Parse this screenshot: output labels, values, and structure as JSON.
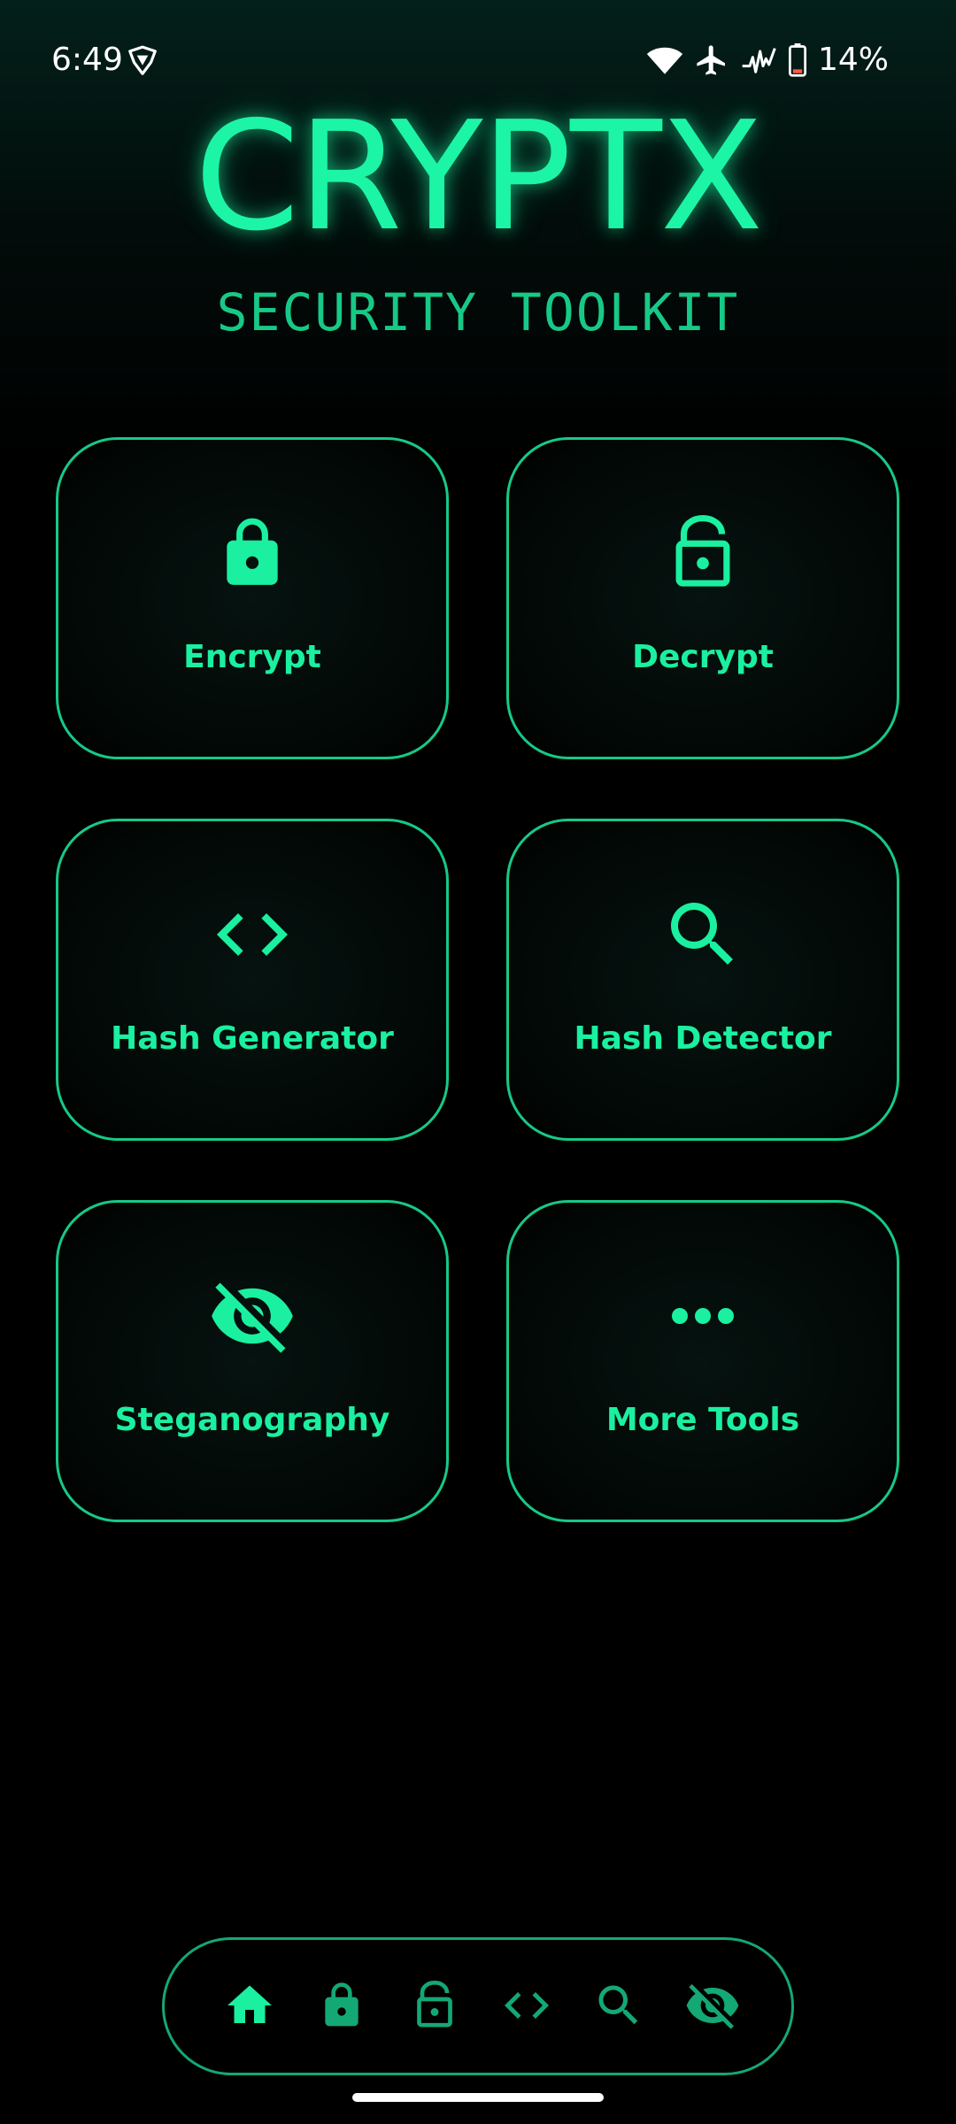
{
  "status_bar": {
    "time": "6:49",
    "battery_percent": "14%",
    "icons": [
      "vpn-shield-icon",
      "wifi-icon",
      "airplane-mode-icon",
      "signal-activity-icon",
      "battery-icon"
    ]
  },
  "header": {
    "title": "CRYPTX",
    "subtitle": "SECURITY TOOLKIT"
  },
  "tools": [
    {
      "label": "Encrypt",
      "icon": "lock-icon"
    },
    {
      "label": "Decrypt",
      "icon": "unlock-icon"
    },
    {
      "label": "Hash Generator",
      "icon": "code-icon"
    },
    {
      "label": "Hash Detector",
      "icon": "search-icon"
    },
    {
      "label": "Steganography",
      "icon": "eye-off-icon"
    },
    {
      "label": "More Tools",
      "icon": "more-dots-icon"
    }
  ],
  "bottom_nav": {
    "items": [
      {
        "icon": "home-icon",
        "active": true
      },
      {
        "icon": "lock-icon",
        "active": false
      },
      {
        "icon": "unlock-icon",
        "active": false
      },
      {
        "icon": "code-icon",
        "active": false
      },
      {
        "icon": "search-icon",
        "active": false
      },
      {
        "icon": "eye-off-icon",
        "active": false
      }
    ]
  },
  "colors": {
    "accent": "#1af0a0",
    "accent_dim": "#17c987",
    "card_border": "#16c987",
    "nav_inactive": "#14a874",
    "background": "#000000"
  }
}
